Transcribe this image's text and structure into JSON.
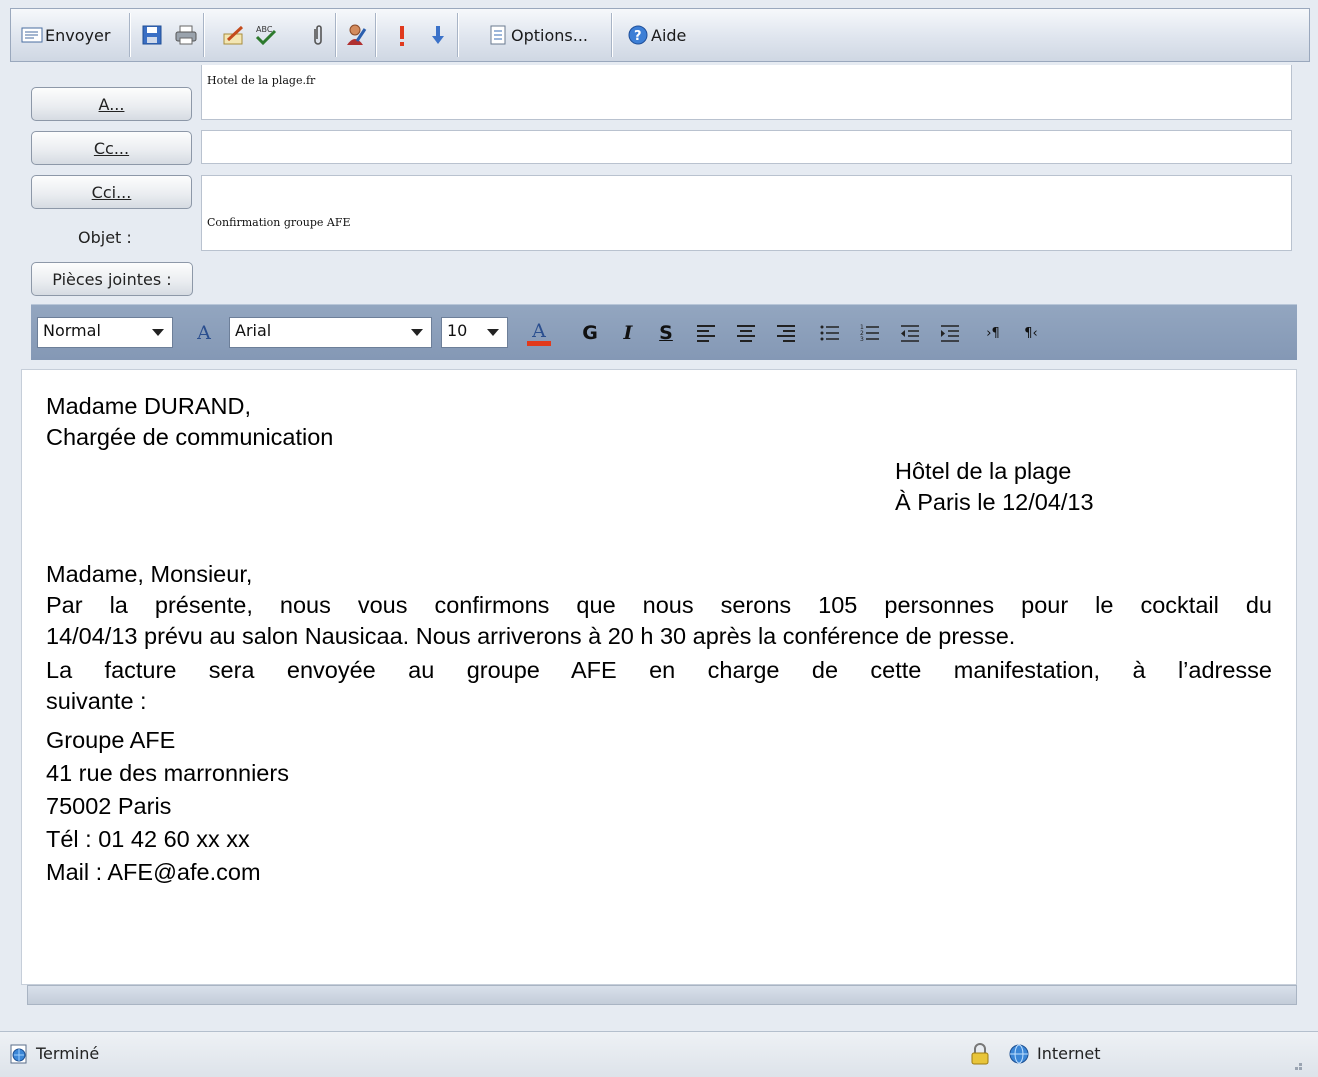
{
  "toolbar": {
    "send_label": "Envoyer",
    "options_label": "Options...",
    "help_label": "Aide",
    "icons": [
      "envelope-icon",
      "save-icon",
      "print-icon",
      "pen-icon",
      "spellcheck-icon",
      "paperclip-icon",
      "address-book-icon",
      "high-priority-icon",
      "low-priority-icon",
      "options-icon",
      "help-icon"
    ]
  },
  "header": {
    "to_button": "A...",
    "cc_button": "Cc...",
    "bcc_button": "Cci...",
    "subject_label": "Objet :",
    "attachments_button": "Pièces jointes :",
    "to_value": "Hotel de la plage.fr",
    "cc_value": "",
    "bcc_value": "",
    "subject_value": "Confirmation groupe AFE"
  },
  "format": {
    "style": "Normal",
    "font": "Arial",
    "size": "10",
    "bold": "G",
    "italic": "I",
    "underline": "S"
  },
  "body": {
    "recipient_name": "Madame DURAND,",
    "recipient_title": "Chargée de communication",
    "sender": "Hôtel de la plage",
    "place_date": "À Paris le 12/04/13",
    "greeting": "Madame, Monsieur,",
    "p1_line1": "Par la présente, nous vous confirmons que nous serons 105 personnes pour le cocktail du",
    "p1_line2": "14/04/13 prévu au salon Nausicaa. Nous arriverons à 20 h 30 après la conférence de presse.",
    "p2_line1": "La facture sera envoyée au groupe AFE en charge de cette manifestation, à l’adresse",
    "p2_line2": "suivante :",
    "addr_name": "Groupe AFE",
    "addr_street": "41 rue des marronniers",
    "addr_city": "75002 Paris",
    "addr_phone": "Tél : 01 42 60 xx xx",
    "addr_mail": "Mail : AFE@afe.com"
  },
  "status": {
    "left": "Terminé",
    "zone": "Internet"
  }
}
